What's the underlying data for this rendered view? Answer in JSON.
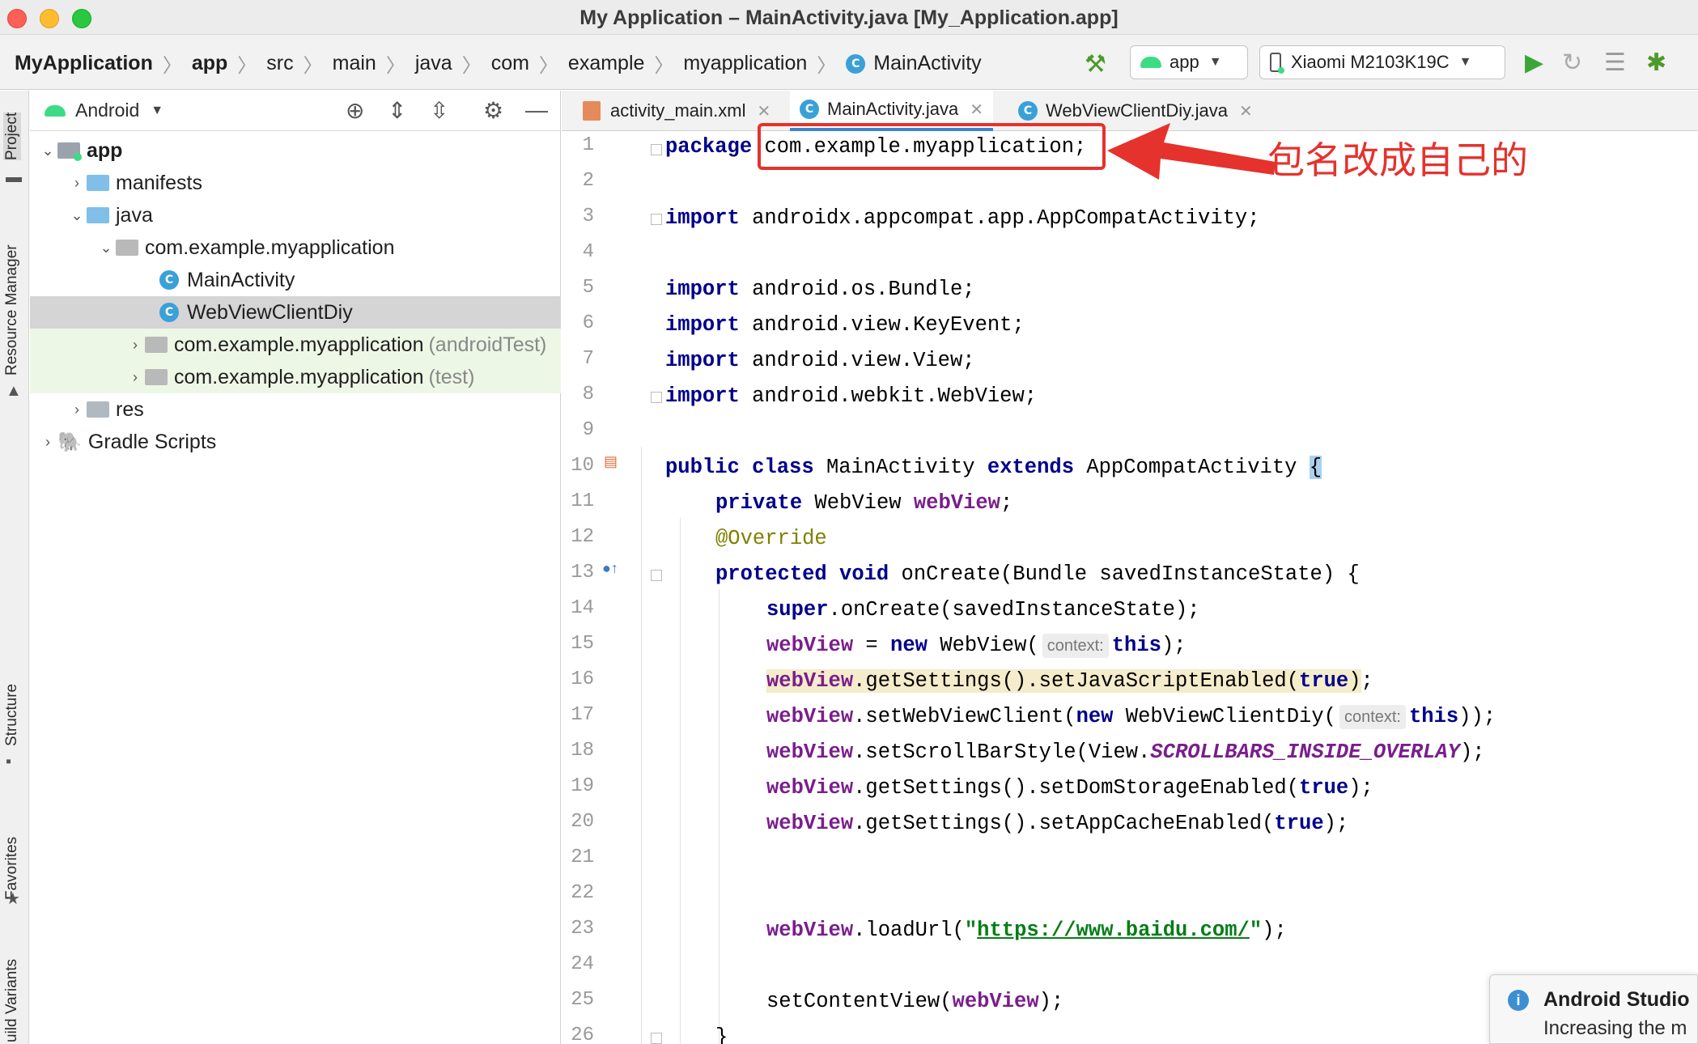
{
  "window": {
    "title": "My Application – MainActivity.java [My_Application.app]"
  },
  "breadcrumbs": [
    {
      "label": "MyApplication",
      "bold": true
    },
    {
      "label": "app",
      "bold": true
    },
    {
      "label": "src"
    },
    {
      "label": "main"
    },
    {
      "label": "java"
    },
    {
      "label": "com"
    },
    {
      "label": "example"
    },
    {
      "label": "myapplication"
    },
    {
      "label": "MainActivity",
      "class_icon": true
    }
  ],
  "toolbar": {
    "run_config": "app",
    "device": "Xiaomi M2103K19C",
    "icons": [
      "hammer-icon",
      "run-icon",
      "apply-changes-icon",
      "logcat-icon",
      "debug-icon"
    ]
  },
  "side_tools": {
    "project": "Project",
    "resource_manager": "Resource Manager",
    "structure": "Structure",
    "favorites": "Favorites",
    "build_variants": "uild Variants"
  },
  "project_panel": {
    "view_mode": "Android",
    "tree": [
      {
        "label": "app",
        "bold": true
      },
      {
        "label": "manifests"
      },
      {
        "label": "java"
      },
      {
        "label": "com.example.myapplication"
      },
      {
        "label": "MainActivity"
      },
      {
        "label": "WebViewClientDiy"
      },
      {
        "label": "com.example.myapplication",
        "suffix": "(androidTest)"
      },
      {
        "label": "com.example.myapplication",
        "suffix": "(test)"
      },
      {
        "label": "res"
      },
      {
        "label": "Gradle Scripts"
      }
    ]
  },
  "editor": {
    "tabs": [
      {
        "label": "activity_main.xml"
      },
      {
        "label": "MainActivity.java",
        "active": true
      },
      {
        "label": "WebViewClientDiy.java"
      }
    ],
    "line_numbers": [
      "1",
      "2",
      "3",
      "4",
      "5",
      "6",
      "7",
      "8",
      "9",
      "10",
      "11",
      "12",
      "13",
      "14",
      "15",
      "16",
      "17",
      "18",
      "19",
      "20",
      "21",
      "22",
      "23",
      "24",
      "25",
      "26"
    ],
    "code": {
      "l1_kw": "package",
      "l1_pkg": "com.example.myapplication;",
      "l3_kw": "import",
      "l3_rest": " androidx.appcompat.app.AppCompatActivity;",
      "l5_kw": "import",
      "l5_rest": " android.os.Bundle;",
      "l6_kw": "import",
      "l6_rest": " android.view.KeyEvent;",
      "l7_kw": "import",
      "l7_rest": " android.view.View;",
      "l8_kw": "import",
      "l8_rest": " android.webkit.WebView;",
      "l10_kw1": "public class",
      "l10_name": " MainActivity ",
      "l10_kw2": "extends",
      "l10_super": " AppCompatActivity ",
      "l10_brace": "{",
      "l11_kw": "private",
      "l11_type": " WebView ",
      "l11_field": "webView",
      "l11_end": ";",
      "l12_ann": "@Override",
      "l13_kw": "protected void",
      "l13_rest": " onCreate(Bundle savedInstanceState) {",
      "l14_kw": "super",
      "l14_rest": ".onCreate(savedInstanceState);",
      "l15_field": "webView",
      "l15_mid": " = ",
      "l15_kw": "new",
      "l15_call": " WebView(",
      "l15_hint": "context:",
      "l15_this": "this",
      "l15_end": ");",
      "l16_field": "webView",
      "l16_call": ".getSettings().setJavaScriptEnabled(",
      "l16_true": "true",
      "l16_close": ")",
      "l16_end": ";",
      "l17_field": "webView",
      "l17_call": ".setWebViewClient(",
      "l17_kw": "new",
      "l17_call2": " WebViewClientDiy(",
      "l17_hint": "context:",
      "l17_this": "this",
      "l17_end": "));",
      "l18_field": "webView",
      "l18_call": ".setScrollBarStyle(View.",
      "l18_const": "SCROLLBARS_INSIDE_OVERLAY",
      "l18_end": ");",
      "l19_field": "webView",
      "l19_call": ".getSettings().setDomStorageEnabled(",
      "l19_true": "true",
      "l19_end": ");",
      "l20_field": "webView",
      "l20_call": ".getSettings().setAppCacheEnabled(",
      "l20_true": "true",
      "l20_end": ");",
      "l23_field": "webView",
      "l23_call": ".loadUrl(",
      "l23_q1": "\"",
      "l23_url": "https://www.baidu.com/",
      "l23_q2": "\"",
      "l23_end": ");",
      "l25_call": "setContentView(",
      "l25_field": "webView",
      "l25_end": ");",
      "l26_brace": "}"
    }
  },
  "annotation": {
    "text": "包名改成自己的",
    "color": "#e5322d"
  },
  "notification": {
    "title": "Android Studio",
    "body": "Increasing the m"
  },
  "colors": {
    "keyword": "#00008b",
    "field": "#7a1e8c",
    "string": "#067d17",
    "annotation": "#808000",
    "accent": "#4083c9"
  }
}
